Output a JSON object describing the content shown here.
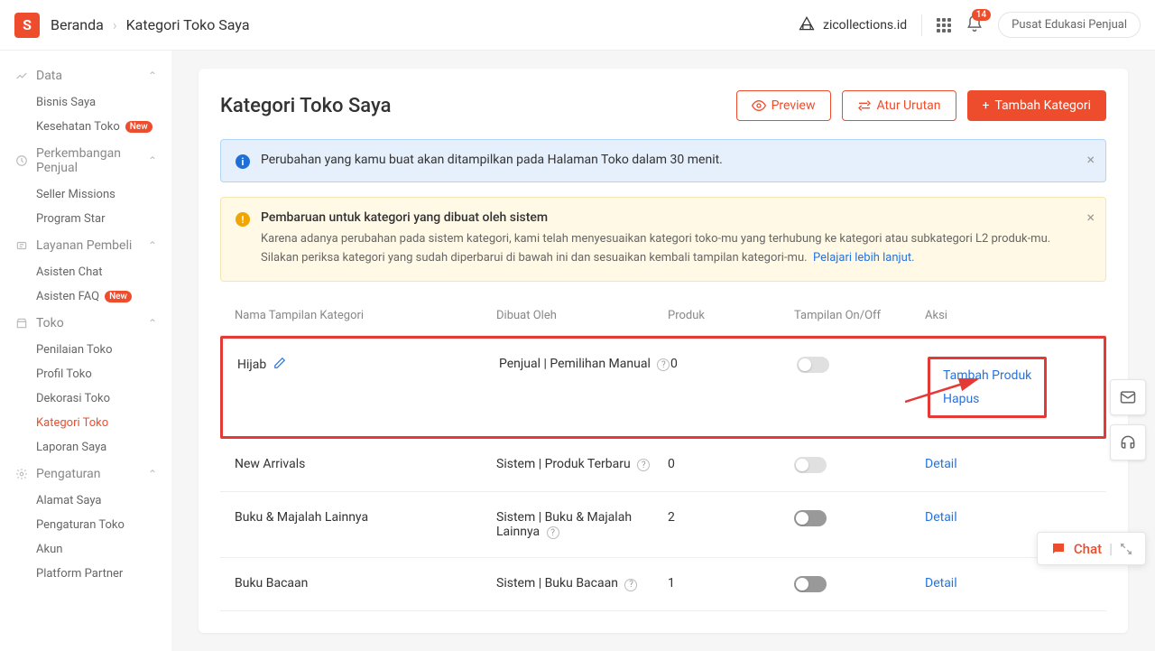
{
  "header": {
    "home": "Beranda",
    "page": "Kategori Toko Saya",
    "shop": "zicollections.id",
    "notif_count": "14",
    "edu_button": "Pusat Edukasi Penjual"
  },
  "sidebar": {
    "groups": [
      {
        "title": "Data",
        "items": [
          {
            "label": "Bisnis Saya"
          },
          {
            "label": "Kesehatan Toko",
            "badge": "New"
          }
        ]
      },
      {
        "title": "Perkembangan Penjual",
        "items": [
          {
            "label": "Seller Missions"
          },
          {
            "label": "Program Star"
          }
        ]
      },
      {
        "title": "Layanan Pembeli",
        "items": [
          {
            "label": "Asisten Chat"
          },
          {
            "label": "Asisten FAQ",
            "badge": "New"
          }
        ]
      },
      {
        "title": "Toko",
        "items": [
          {
            "label": "Penilaian Toko"
          },
          {
            "label": "Profil Toko"
          },
          {
            "label": "Dekorasi Toko"
          },
          {
            "label": "Kategori Toko",
            "active": true
          },
          {
            "label": "Laporan Saya"
          }
        ]
      },
      {
        "title": "Pengaturan",
        "items": [
          {
            "label": "Alamat Saya"
          },
          {
            "label": "Pengaturan Toko"
          },
          {
            "label": "Akun"
          },
          {
            "label": "Platform Partner"
          }
        ]
      }
    ]
  },
  "page": {
    "title": "Kategori Toko Saya",
    "actions": {
      "preview": "Preview",
      "sort": "Atur Urutan",
      "add": "Tambah Kategori"
    },
    "info_alert": "Perubahan yang kamu buat akan ditampilkan pada Halaman Toko dalam 30 menit.",
    "warning_alert": {
      "title": "Pembaruan untuk kategori yang dibuat oleh sistem",
      "desc": "Karena adanya perubahan pada sistem kategori, kami telah menyesuaikan kategori toko-mu yang terhubung ke kategori atau subkategori L2 produk-mu. Silakan periksa kategori yang sudah diperbarui di bawah ini dan sesuaikan kembali tampilan kategori-mu.",
      "link": "Pelajari lebih lanjut."
    },
    "columns": {
      "name": "Nama Tampilan Kategori",
      "created": "Dibuat Oleh",
      "product": "Produk",
      "toggle": "Tampilan On/Off",
      "action": "Aksi"
    },
    "rows": [
      {
        "name": "Hijab",
        "created": "Penjual | Pemilihan Manual",
        "product": "0",
        "actions": [
          "Tambah Produk",
          "Hapus"
        ],
        "highlight": true,
        "editable": true,
        "help": true
      },
      {
        "name": "New Arrivals",
        "created": "Sistem | Produk Terbaru",
        "product": "0",
        "actions": [
          "Detail"
        ],
        "help_inline": true
      },
      {
        "name": "Buku & Majalah Lainnya",
        "created": "Sistem | Buku & Majalah Lainnya",
        "product": "2",
        "actions": [
          "Detail"
        ],
        "help_inline": true,
        "toggle_dark": true
      },
      {
        "name": "Buku Bacaan",
        "created": "Sistem | Buku Bacaan",
        "product": "1",
        "actions": [
          "Detail"
        ],
        "help_inline": true,
        "toggle_dark": true
      }
    ]
  },
  "chat": {
    "label": "Chat"
  }
}
